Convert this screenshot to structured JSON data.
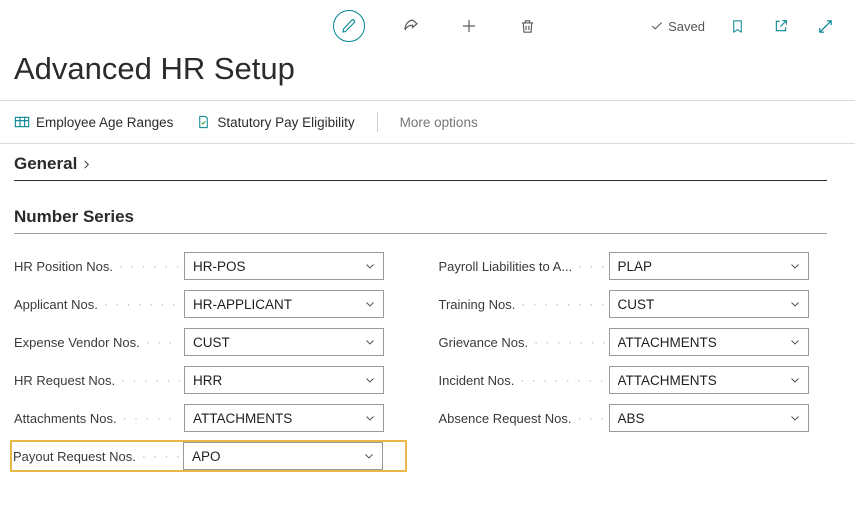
{
  "toolbar": {
    "saved_label": "Saved"
  },
  "page": {
    "title": "Advanced HR Setup"
  },
  "actions": {
    "employee_age": "Employee Age Ranges",
    "statutory": "Statutory Pay Eligibility",
    "more": "More options"
  },
  "sections": {
    "general": "General",
    "number_series": "Number Series"
  },
  "fields_left": [
    {
      "label": "HR Position Nos.",
      "value": "HR-POS"
    },
    {
      "label": "Applicant Nos.",
      "value": "HR-APPLICANT"
    },
    {
      "label": "Expense Vendor Nos.",
      "value": "CUST"
    },
    {
      "label": "HR Request Nos.",
      "value": "HRR"
    },
    {
      "label": "Attachments Nos.",
      "value": "ATTACHMENTS"
    },
    {
      "label": "Payout Request Nos.",
      "value": "APO"
    }
  ],
  "fields_right": [
    {
      "label": "Payroll Liabilities to A...",
      "value": "PLAP"
    },
    {
      "label": "Training Nos.",
      "value": "CUST"
    },
    {
      "label": "Grievance Nos.",
      "value": "ATTACHMENTS"
    },
    {
      "label": "Incident Nos.",
      "value": "ATTACHMENTS"
    },
    {
      "label": "Absence Request Nos.",
      "value": "ABS"
    }
  ],
  "highlight_left_index": 5
}
